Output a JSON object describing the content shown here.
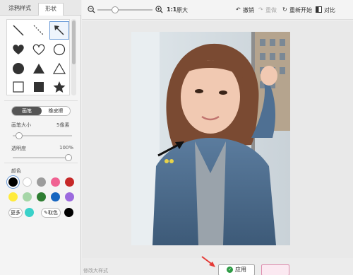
{
  "left_panel": {
    "tabs": [
      "涂鸦样式",
      "形状"
    ],
    "pen_modes": {
      "pen": "画笔",
      "eraser": "橡皮擦"
    },
    "brush_size": {
      "label": "画笔大小",
      "value": "5像素",
      "level": 0.05
    },
    "opacity": {
      "label": "透明度",
      "value": "100%",
      "level": 1.0
    },
    "color_label": "颜色",
    "more_label": "更多",
    "pick_label": "取色",
    "shapes": [
      "line",
      "dashed-line",
      "arrow",
      "heart-filled",
      "heart-outline",
      "circle-outline",
      "circle-filled",
      "triangle-filled",
      "triangle-outline",
      "square-outline",
      "square-filled",
      "star-filled"
    ],
    "colors": [
      "#000000",
      "#ffffff",
      "#9c9c9c",
      "#f06292",
      "#c62828",
      "#ffeb3b",
      "#a5d6a7",
      "#2e7d32",
      "#1565c0",
      "#9c6ade"
    ],
    "more_color": "#3ad1c9",
    "pick_color": "#000000"
  },
  "toolbar": {
    "ratio": "1:1",
    "original": "原大",
    "undo": "撤销",
    "redo": "重做",
    "restart": "重新开始",
    "compare": "对比"
  },
  "bottom": {
    "apply": "应用",
    "partial": "修改大样式"
  }
}
